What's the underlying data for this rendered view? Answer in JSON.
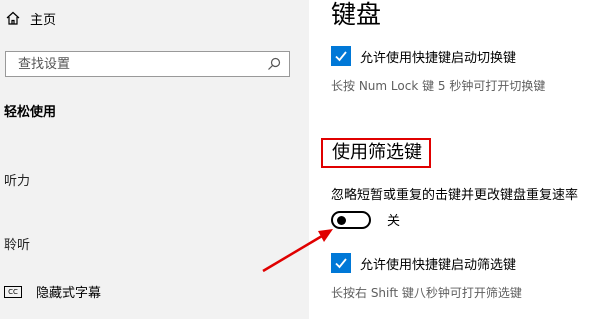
{
  "sidebar": {
    "home_label": "主页",
    "search_placeholder": "查找设置",
    "section_title": "轻松使用",
    "items": [
      {
        "label": "听力"
      },
      {
        "label": "聆听"
      }
    ],
    "captions_label": "隐藏式字幕",
    "captions_icon_text": "CC"
  },
  "main": {
    "page_title": "键盘",
    "sticky_checkbox_label": "允许使用快捷键启动切换键",
    "sticky_hint": "长按 Num Lock 键 5 秒钟可打开切换键",
    "filter_title": "使用筛选键",
    "filter_desc": "忽略短暂或重复的击键并更改键盘重复速率",
    "filter_toggle_state": "关",
    "filter_checkbox_label": "允许使用快捷键启动筛选键",
    "filter_hint": "长按右 Shift 键八秒钟可打开筛选键"
  },
  "colors": {
    "accent": "#0078d7",
    "highlight": "#e00000",
    "sidebar_bg": "#f2f2f2"
  },
  "icons": [
    "home-icon",
    "search-icon",
    "checkmark-icon",
    "closed-captions-icon",
    "annotation-arrow"
  ]
}
